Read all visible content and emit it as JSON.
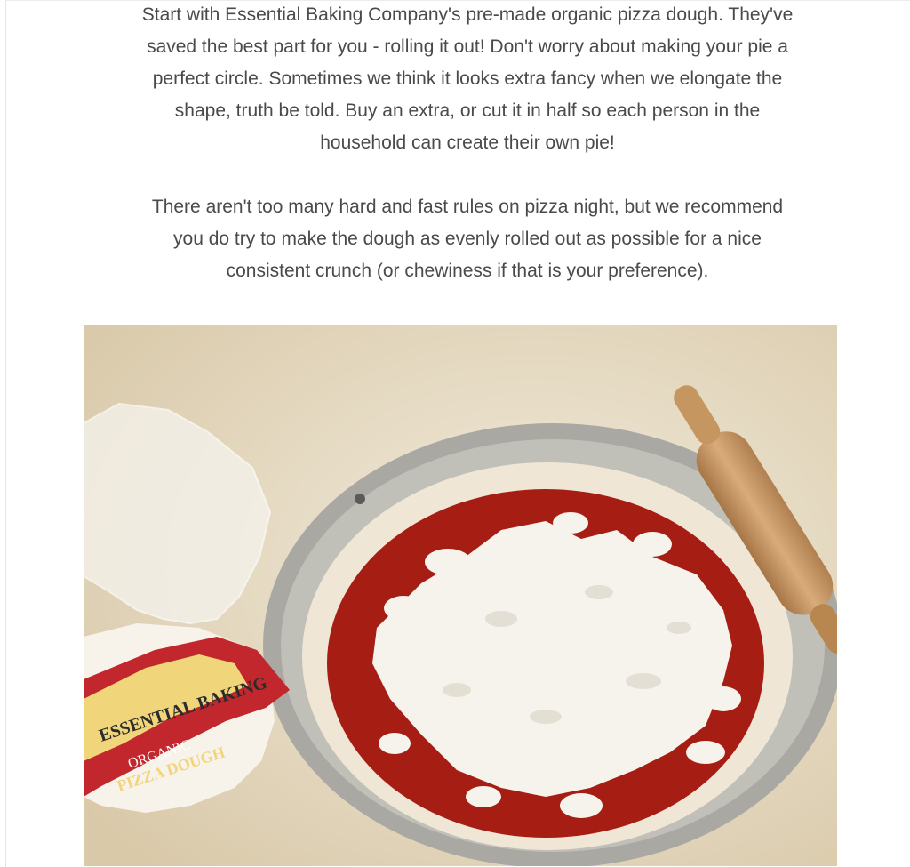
{
  "article": {
    "paragraphs": [
      {
        "lines": [
          "Start with Essential Baking Company's pre-made organic pizza dough. They've",
          "saved the best part for you - rolling it out! Don't worry about making your pie a",
          "perfect circle. Sometimes we think it looks extra fancy when we elongate the",
          "shape, truth be told. Buy an extra, or cut it in half so each person in the",
          "household can create their own pie!"
        ]
      },
      {
        "lines": [
          "There aren't too many hard and fast rules on pizza night, but we recommend",
          "you do try to make the dough as evenly rolled out as possible for a nice",
          "consistent crunch (or chewiness if that is your preference)."
        ]
      }
    ],
    "photo": {
      "package_label": {
        "brand_line1": "ESSENTIAL BAKING",
        "brand_line2": "ORGANIC",
        "product": "PIZZA DOUGH"
      },
      "colors": {
        "counter": "#ebe1cc",
        "sauce": "#a61d14",
        "cheese": "#f6f3ec",
        "dough": "#efe6d6",
        "pan": "#a9a8a2",
        "rolling_pin": "#c99a6a",
        "package_red": "#c1272d",
        "package_yellow": "#f1d57a"
      }
    }
  }
}
